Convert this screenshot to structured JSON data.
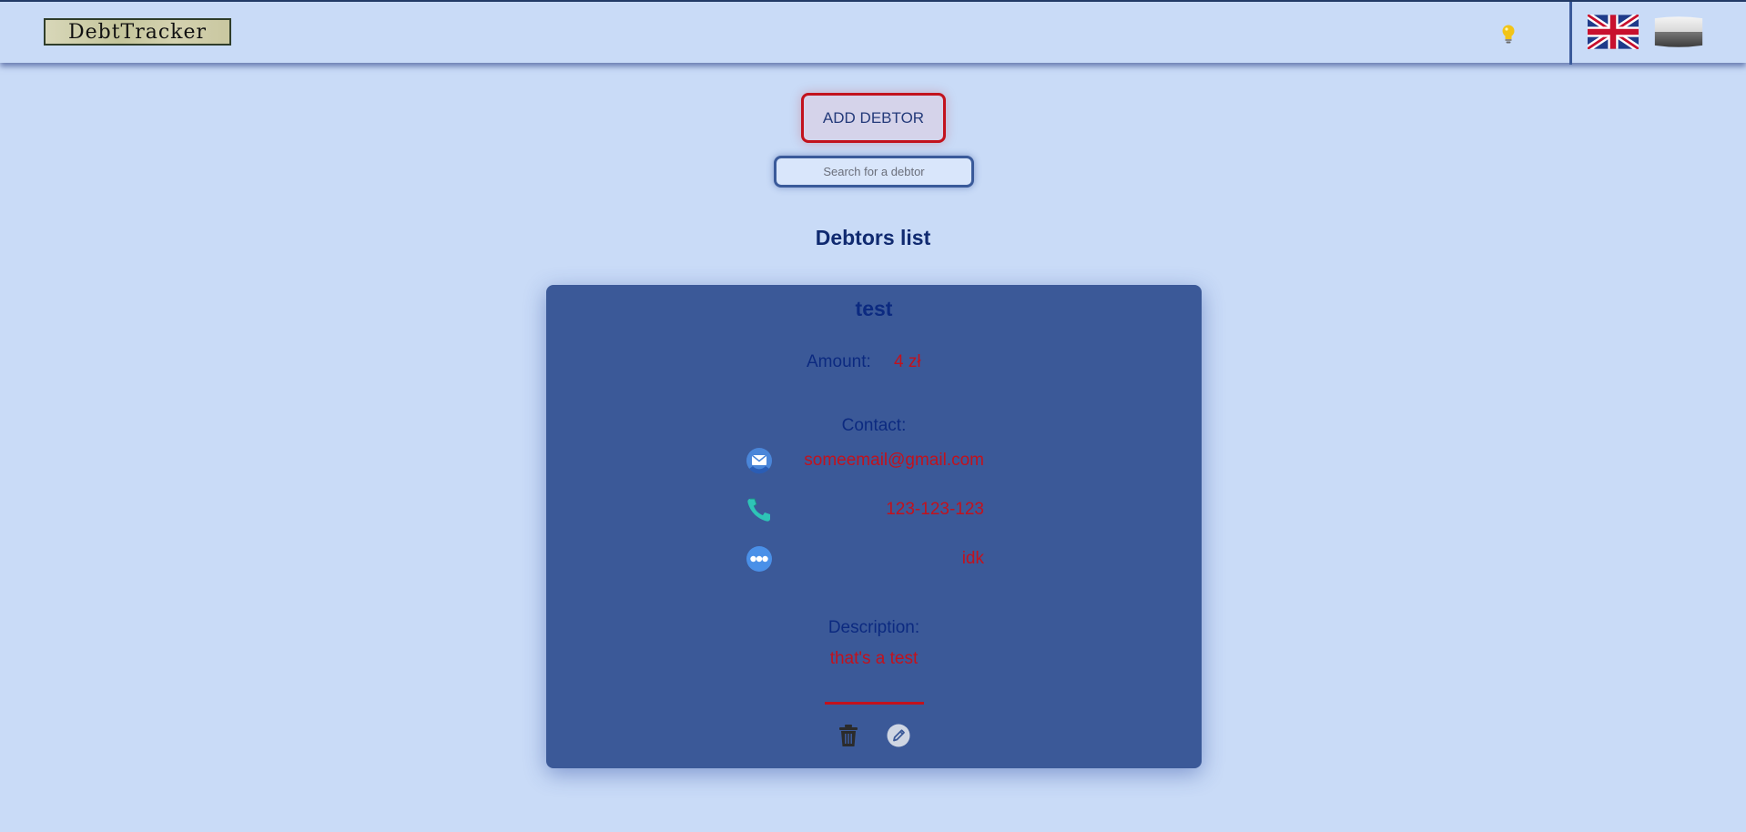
{
  "header": {
    "logo_text": "DebtTracker",
    "theme_toggle_icon": "lightbulb-icon",
    "languages": [
      {
        "name": "english-flag-icon"
      },
      {
        "name": "polish-flag-icon"
      }
    ]
  },
  "actions": {
    "add_debtor_label": "ADD DEBTOR",
    "search_placeholder": "Search for a debtor"
  },
  "list": {
    "title": "Debtors list",
    "debtors": [
      {
        "name": "test",
        "amount_label": "Amount:",
        "amount_value": "4 zł",
        "contact_label": "Contact:",
        "contacts": [
          {
            "icon": "email-icon",
            "value": "someemail@gmail.com"
          },
          {
            "icon": "phone-icon",
            "value": "123-123-123"
          },
          {
            "icon": "more-icon",
            "value": "idk"
          }
        ],
        "description_label": "Description:",
        "description_value": "that's a test",
        "action_icons": [
          "trash-icon",
          "edit-icon"
        ]
      }
    ]
  },
  "colors": {
    "background": "#c9dbf7",
    "card": "#3b5998",
    "accent_red": "#c2121d",
    "text_blue": "#0c2a80"
  }
}
